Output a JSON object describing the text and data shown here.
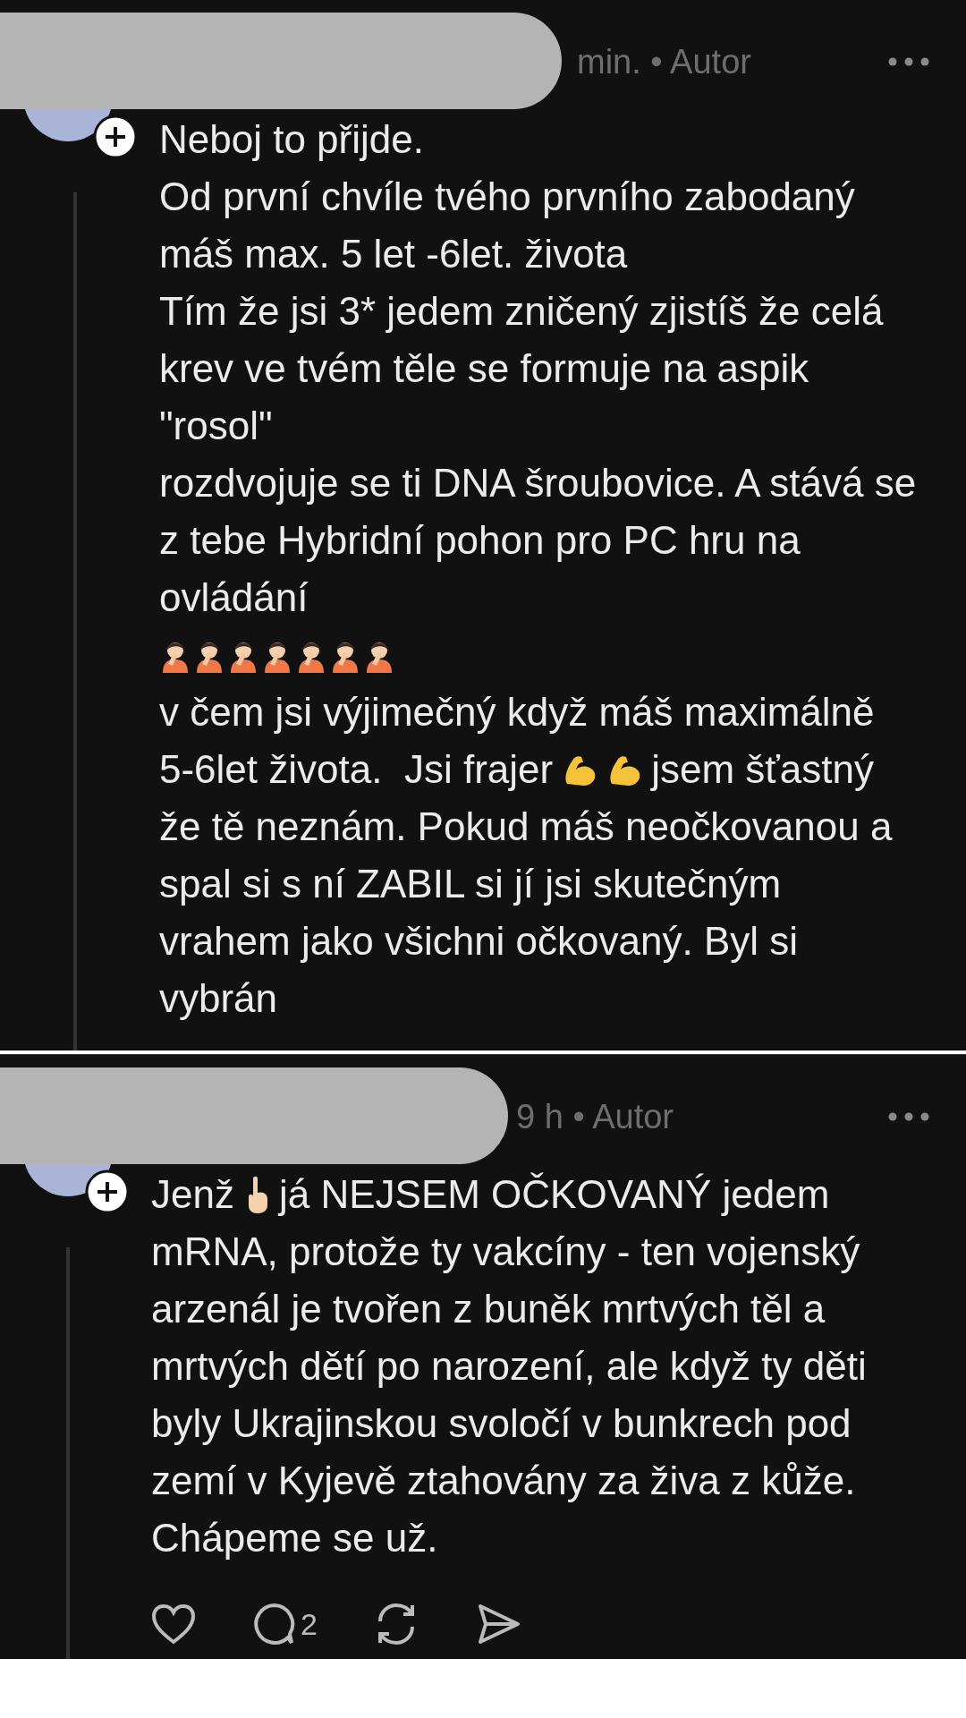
{
  "comments": [
    {
      "meta": "min. • Autor",
      "lines": [
        {
          "text": "Neboj to přijde."
        },
        {
          "text": "Od první chvíle tvého prvního zabodaný"
        },
        {
          "text": "máš max. 5 let -6let. života"
        },
        {
          "text": "Tím že jsi 3* jedem zničený zjistíš že celá"
        },
        {
          "text": "krev ve tvém těle se formuje na aspik"
        },
        {
          "text": "\"rosol\""
        },
        {
          "text": "rozdvojuje se ti DNA šroubovice. A stává se"
        },
        {
          "text": "z tebe Hybridní pohon pro PC hru na"
        },
        {
          "text": "ovládání"
        },
        {
          "parts": [
            {
              "kind": "facepalm"
            },
            {
              "kind": "facepalm"
            },
            {
              "kind": "facepalm"
            },
            {
              "kind": "facepalm"
            },
            {
              "kind": "facepalm"
            },
            {
              "kind": "facepalm"
            },
            {
              "kind": "facepalm"
            }
          ]
        },
        {
          "text": "v čem jsi výjimečný když máš maximálně"
        },
        {
          "parts": [
            {
              "text": "5-6let života.  Jsi frajer"
            },
            {
              "kind": "flex"
            },
            {
              "kind": "flex"
            },
            {
              "text": "jsem šťastný"
            }
          ]
        },
        {
          "text": "že tě neznám. Pokud máš neočkovanou a"
        },
        {
          "text": "spal si s ní ZABIL si jí jsi skutečným"
        },
        {
          "text": "vrahem jako všichni očkovaný. Byl si"
        },
        {
          "text": "vybrán"
        }
      ]
    },
    {
      "meta": "9 h • Autor",
      "lines": [
        {
          "parts": [
            {
              "text": "Jenž"
            },
            {
              "kind": "point"
            },
            {
              "text": "já NEJSEM OČKOVANÝ jedem"
            }
          ]
        },
        {
          "text": "mRNA, protože ty vakcíny - ten vojenský"
        },
        {
          "text": "arzenál je tvořen z buněk mrtvých těl a"
        },
        {
          "text": "mrtvých dětí po narození, ale když ty děti"
        },
        {
          "text": "byly Ukrajinskou svoločí v bunkrech pod"
        },
        {
          "text": "zemí v Kyjevě ztahovány za živa z kůže."
        },
        {
          "text": "Chápeme se už."
        }
      ],
      "actions": {
        "reply_count": "2"
      }
    }
  ]
}
